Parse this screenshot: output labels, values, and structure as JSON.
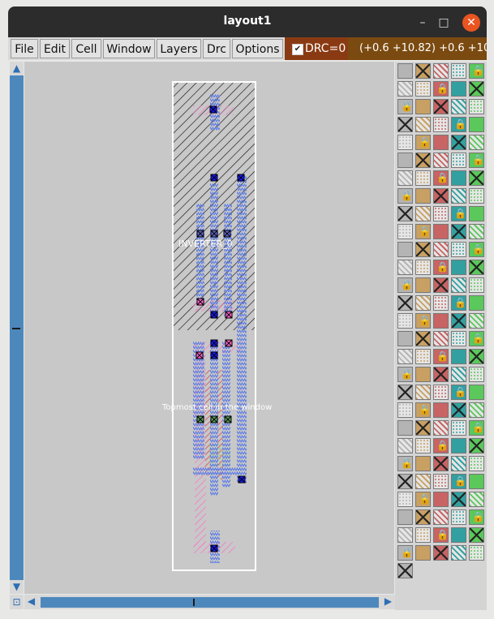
{
  "window": {
    "title": "layout1"
  },
  "window_controls": {
    "minimize": "–",
    "maximize": "□",
    "close": "✕"
  },
  "menu": [
    "File",
    "Edit",
    "Cell",
    "Window",
    "Layers",
    "Drc",
    "Options"
  ],
  "drc": {
    "label": "DRC=0",
    "checked": true
  },
  "coordinates": "(+0.6 +10.82) +0.6 +10",
  "layout": {
    "cell_label": "INVERTER_0",
    "window_label": "Topmost cell in the window"
  },
  "palette": {
    "swatch_count": 141,
    "colors": [
      "#b4b4b4",
      "#c8c8a0",
      "#c86464",
      "#a08060",
      "#5ac85a",
      "#2ec82e",
      "#6464c8",
      "#c8a064",
      "#b482b4",
      "#32a0a0",
      "#ff64c8",
      "#000000"
    ]
  }
}
